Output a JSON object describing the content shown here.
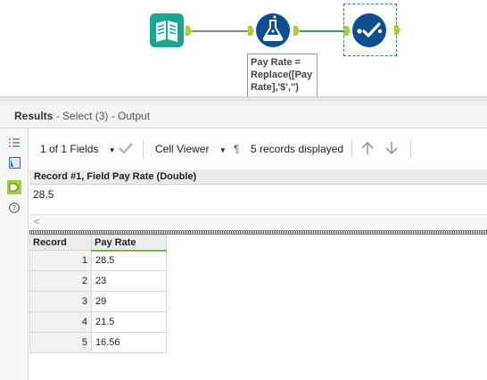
{
  "workflow": {
    "annotation": "Pay Rate =\nReplace([Pay\nRate],'$','')",
    "colors": {
      "input_tool": "#1aa596",
      "formula_tool": "#0d4e91",
      "select_tool": "#0d4e91",
      "anchor": "#a7cf3c"
    },
    "icons": [
      "book-input-icon",
      "flask-formula-icon",
      "select-checkmark-icon"
    ]
  },
  "results": {
    "title": "Results",
    "subtitle": " - Select (3) - Output"
  },
  "toolbar": {
    "fields_label": "1 of 1 Fields",
    "viewer_label": "Cell Viewer",
    "pilcrow": "¶",
    "records_label": "5 records displayed"
  },
  "cell_viewer": {
    "header": "Record #1, Field Pay Rate (Double)",
    "value": "28.5",
    "scroll_left": "<"
  },
  "grid": {
    "columns": [
      "Record",
      "Pay Rate"
    ],
    "rows": [
      {
        "record": "1",
        "pay_rate": "28.5"
      },
      {
        "record": "2",
        "pay_rate": "23"
      },
      {
        "record": "3",
        "pay_rate": "29"
      },
      {
        "record": "4",
        "pay_rate": "21.5"
      },
      {
        "record": "5",
        "pay_rate": "16.56"
      }
    ]
  }
}
